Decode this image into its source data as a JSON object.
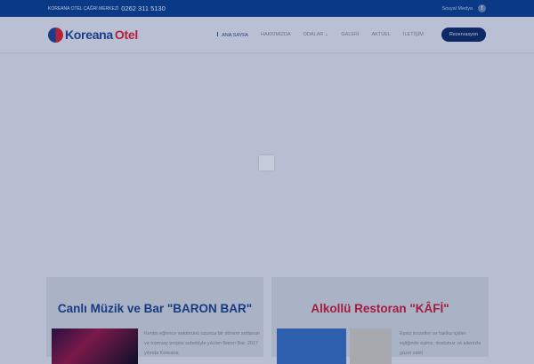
{
  "topbar": {
    "call_center_label": "KOREANA OTEL ÇAĞRI MERKEZİ",
    "phone": "0262 311 5130",
    "social_label": "Sosyal Medya",
    "facebook_icon": "f"
  },
  "logo": {
    "part1": "Koreana",
    "part2": "Otel"
  },
  "menu": [
    "ANA SAYFA",
    "HAKKIMIZDA",
    "ODALAR ⌄",
    "GALERİ",
    "AKTÜEL",
    "İLETİŞİM"
  ],
  "reservation_button": "Rezervasyon",
  "cards": [
    {
      "title": "Canlı Müzik ve Bar \"BARON BAR\"",
      "text": "Kentin eğlence sektörünü uzunca bir dönem sırtlanan ve tramvay projesi sebebiyle yıkılan Baron Bar, 2017 yılında Koreana"
    },
    {
      "title": "Alkollü Restoran \"KÂFİ\"",
      "text": "Eşsiz lezzetler ve harika içkiler eşliğinde eşiniz, dostunuz ve ailenizle güzel vakit"
    }
  ]
}
